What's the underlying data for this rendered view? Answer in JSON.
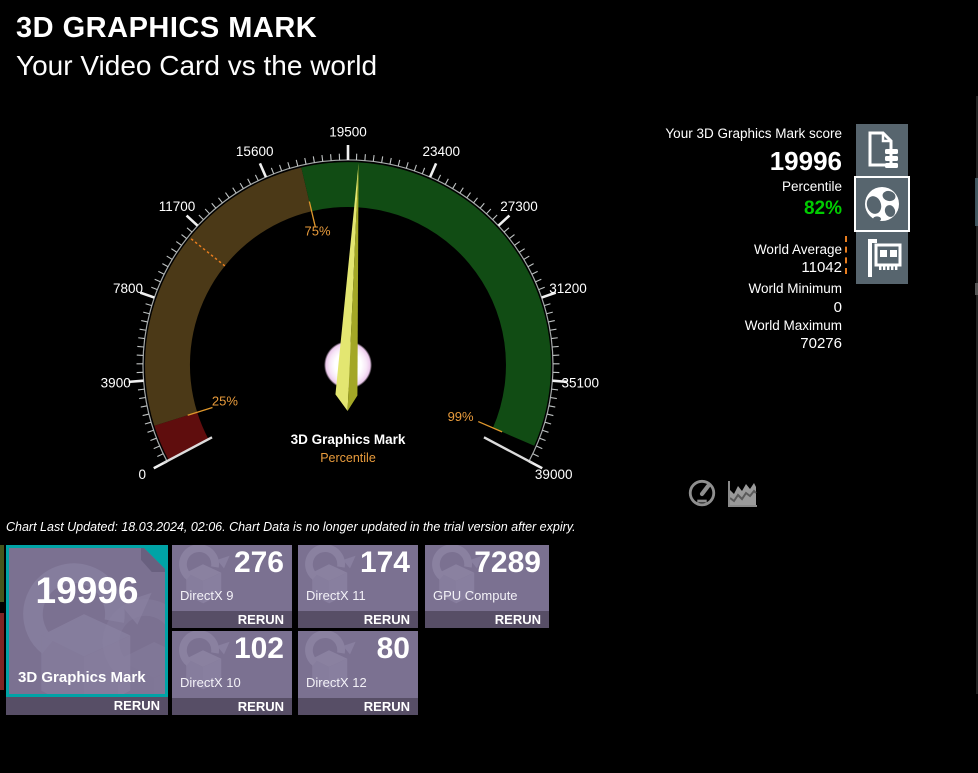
{
  "header": {
    "title": "3D GRAPHICS MARK",
    "subtitle": "Your Video Card vs the world"
  },
  "chart_data": {
    "type": "gauge",
    "center_label": "3D Graphics Mark",
    "center_sublabel": "Percentile",
    "min": 0,
    "max": 39000,
    "value": 19996,
    "tick_major": 3900,
    "tick_minor": 390,
    "start_angle_deg": -118,
    "end_angle_deg": 118,
    "tick_labels": [
      "0",
      "3900",
      "7800",
      "11700",
      "15600",
      "19500",
      "23400",
      "27300",
      "31200",
      "35100",
      "39000"
    ],
    "bands": [
      {
        "from": 0,
        "to": 1750,
        "color": "#5f0d0d"
      },
      {
        "from": 1750,
        "to": 17300,
        "color": "#4b3917"
      },
      {
        "from": 17300,
        "to": 38250,
        "color": "#114c14"
      }
    ],
    "percentile_markers": [
      {
        "label": "25%",
        "value": 1750
      },
      {
        "label": "75%",
        "value": 17300
      },
      {
        "label": "99%",
        "value": 38250
      }
    ],
    "world_average_value": 11042,
    "colors": {
      "needle_light": "#e3e671",
      "needle_dark": "#a3a726",
      "marker_orange": "#e89b3c",
      "world_average_dash": "#e87d1e"
    }
  },
  "side_panel": {
    "score_heading": "Your 3D Graphics Mark score",
    "score": "19996",
    "percentile_heading": "Percentile",
    "percentile": "82%",
    "percentile_color": "#00cc00",
    "stats": [
      {
        "label": "World Average",
        "value": "11042"
      },
      {
        "label": "World Minimum",
        "value": "0"
      },
      {
        "label": "World Maximum",
        "value": "70276"
      }
    ],
    "icons": [
      {
        "name": "report-icon",
        "selected": false
      },
      {
        "name": "globe-icon",
        "selected": true
      },
      {
        "name": "gpu-card-icon",
        "selected": false
      }
    ]
  },
  "view_toggle": {
    "icons": [
      {
        "name": "gauge-view-icon"
      },
      {
        "name": "area-chart-view-icon"
      }
    ]
  },
  "footer": {
    "note": "Chart Last Updated: 18.03.2024, 02:06. Chart Data is no longer updated in the trial version after expiry."
  },
  "tiles": {
    "rerun_label": "RERUN",
    "main": {
      "score": "19996",
      "label": "3D Graphics Mark",
      "selected": true,
      "accent": "#00a3a6"
    },
    "items": [
      {
        "score": "276",
        "label": "DirectX 9"
      },
      {
        "score": "174",
        "label": "DirectX 11"
      },
      {
        "score": "7289",
        "label": "GPU Compute"
      },
      {
        "score": "102",
        "label": "DirectX 10"
      },
      {
        "score": "80",
        "label": "DirectX 12"
      }
    ]
  },
  "colors": {
    "background": "#000000",
    "tile_purple": "#7b7191",
    "tile_strip": "#574e66",
    "tile_accent_teal": "#00a3a6",
    "icon_slate": "#57656e",
    "percent_green": "#00cc00",
    "orange": "#e89b3c"
  }
}
